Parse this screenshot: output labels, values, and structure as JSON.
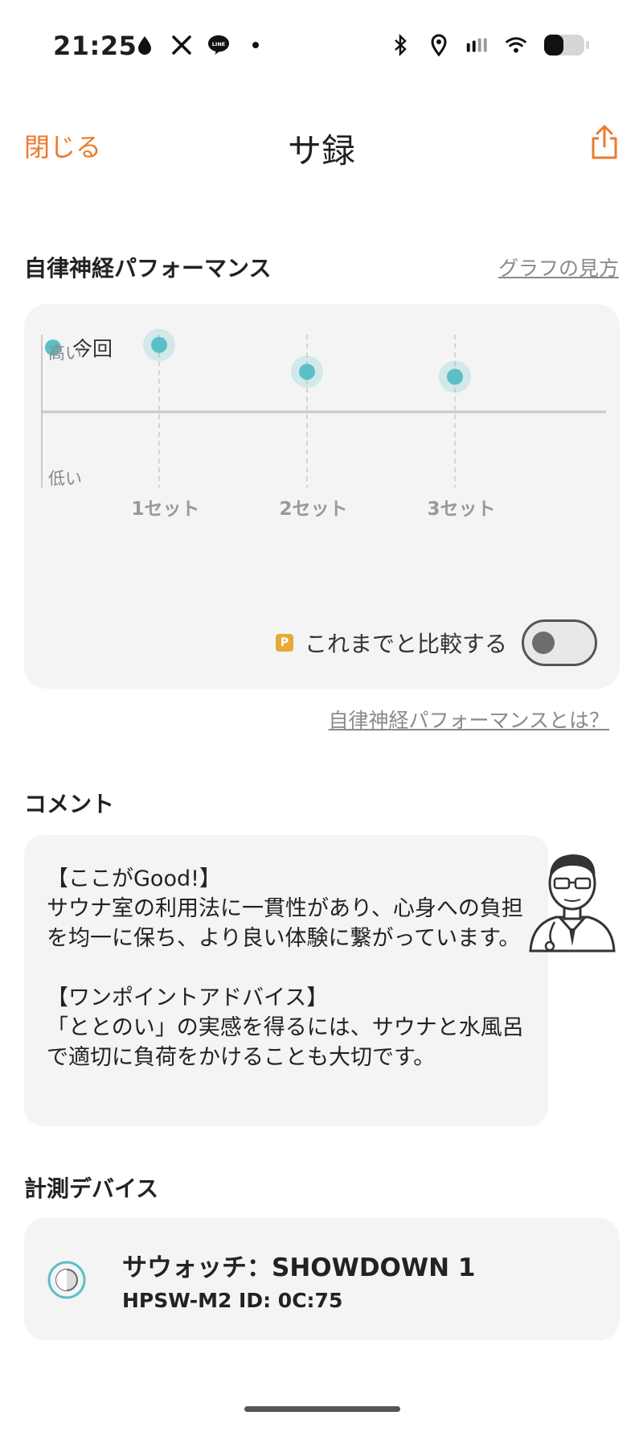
{
  "status_bar": {
    "time": "21:25",
    "left_icons": [
      "drop-icon",
      "x-icon",
      "line-icon",
      "dot-icon"
    ],
    "right_icons": [
      "bluetooth-icon",
      "location-icon",
      "signal-icon",
      "wifi-icon",
      "battery-icon"
    ]
  },
  "header": {
    "close_label": "閉じる",
    "title": "サ録",
    "share_icon": "share-icon"
  },
  "colors": {
    "accent": "#ec7a2c",
    "teal": "#5bc0c6",
    "card_bg": "#f4f4f4",
    "badge": "#e8a93a"
  },
  "performance": {
    "title": "自律神経パフォーマンス",
    "help_link": "グラフの見方",
    "about_link": "自律神経パフォーマンスとは？",
    "compare_badge": "P",
    "compare_label": "これまでと比較する",
    "compare_enabled": false
  },
  "chart_data": {
    "type": "scatter",
    "legend": [
      "今回"
    ],
    "y_top_label": "高い",
    "y_bottom_label": "低い",
    "categories": [
      "1セット",
      "2セット",
      "3セット"
    ],
    "series": [
      {
        "name": "今回",
        "values": [
          0.8,
          0.48,
          0.42
        ]
      }
    ],
    "ylim": [
      -1,
      1
    ],
    "grid": "vertical dashed at each category, horizontal baseline at 0"
  },
  "comment": {
    "title": "コメント",
    "good_heading": "【ここがGood!】",
    "good_text": "サウナ室の利用法に一貫性があり、心身への負担を均一に保ち、より良い体験に繋がっています。",
    "advice_heading": "【ワンポイントアドバイス】",
    "advice_text": "「ととのい」の実感を得るには、サウナと水風呂で適切に負荷をかけることも大切です。",
    "avatar_icon": "doctor-icon"
  },
  "device": {
    "title": "計測デバイス",
    "name": "サウォッチ：SHOWDOWN 1",
    "id_line": "HPSW-M2  ID: 0C:75",
    "icon": "watch-icon"
  }
}
